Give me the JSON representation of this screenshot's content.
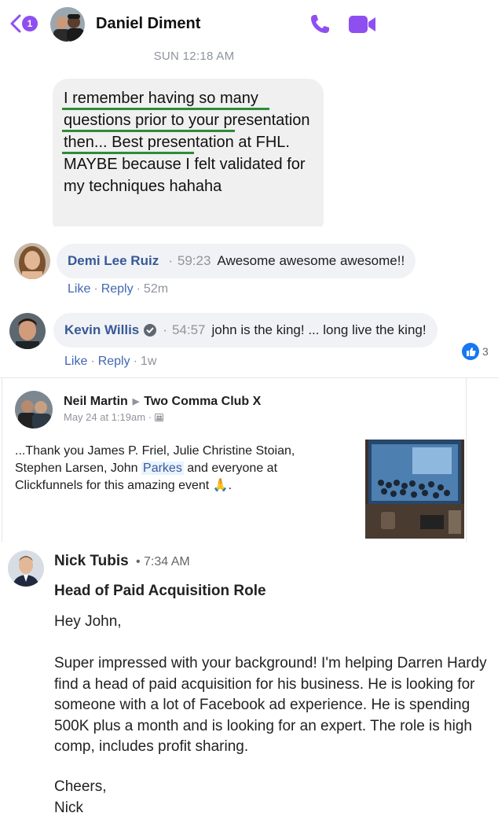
{
  "messenger": {
    "unread_count": "1",
    "contact_name": "Daniel Diment",
    "timestamp": "SUN 12:18 AM",
    "message": "I remember having so many questions prior to your presentation then... Best presentation at FHL. MAYBE because I felt validated for my techniques hahaha",
    "accent_color": "#8f4ff0",
    "icons": [
      "chevron-left-icon",
      "phone-icon",
      "video-camera-icon"
    ]
  },
  "comments": [
    {
      "name": "Demi Lee Ruiz",
      "video_time": "59:23",
      "text": "Awesome awesome awesome!!",
      "like_label": "Like",
      "reply_label": "Reply",
      "age": "52m"
    },
    {
      "name": "Kevin Willis",
      "video_time": "54:57",
      "text": "john is the king! ... long live the king!",
      "like_label": "Like",
      "reply_label": "Reply",
      "age": "1w",
      "reaction_count": "3"
    }
  ],
  "post": {
    "author": "Neil Martin",
    "group": "Two Comma Club X",
    "date": "May 24 at 1:19am",
    "body_before": "...Thank you James P. Friel, Julie Christine Stoian, Stephen Larsen, John ",
    "tagged": "Parkes",
    "body_after": " and everyone at Clickfunnels for this amazing event 🙏."
  },
  "linkedin": {
    "sender": "Nick Tubis",
    "time": "7:34 AM",
    "subject": "Head of Paid Acquisition Role",
    "greeting": "Hey John,",
    "body": "Super impressed with your background! I'm helping Darren Hardy find a head of paid acquisition for his business. He is looking for someone with a lot of Facebook ad experience. He is spending 500K plus a month and is looking for an expert. The role is high comp, includes profit sharing.",
    "signoff": "Cheers,",
    "signature": "Nick"
  }
}
